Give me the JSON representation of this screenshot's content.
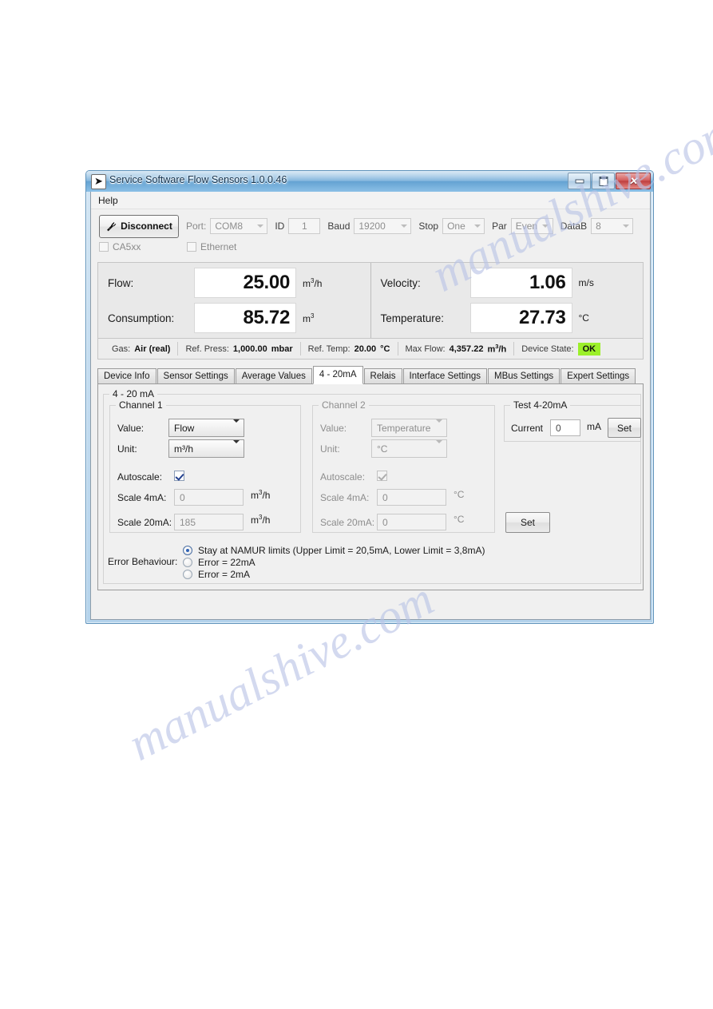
{
  "window": {
    "title": "Service Software Flow Sensors 1.0.0.46",
    "icon": "app-icon",
    "buttons": {
      "minimize": "minimize-icon",
      "maximize": "maximize-icon",
      "close": "close-icon"
    }
  },
  "menubar": {
    "items": [
      {
        "label": "Help"
      }
    ]
  },
  "toolbar": {
    "connect_button": "Disconnect",
    "port": {
      "label": "Port:",
      "value": "COM8"
    },
    "id": {
      "label": "ID",
      "value": "1"
    },
    "baud": {
      "label": "Baud",
      "value": "19200"
    },
    "stop": {
      "label": "Stop",
      "value": "One"
    },
    "par": {
      "label": "Par",
      "value": "Even"
    },
    "datab": {
      "label": "DataB",
      "value": "8"
    },
    "ca5xx": {
      "label": "CA5xx",
      "checked": false
    },
    "ethernet": {
      "label": "Ethernet",
      "checked": false
    }
  },
  "measurements": {
    "flow": {
      "label": "Flow:",
      "value": "25.00",
      "unit": "m",
      "unit_sup": "3",
      "unit_tail": "/h"
    },
    "consumption": {
      "label": "Consumption:",
      "value": "85.72",
      "unit": "m",
      "unit_sup": "3",
      "unit_tail": ""
    },
    "velocity": {
      "label": "Velocity:",
      "value": "1.06",
      "unit": "m/s",
      "unit_sup": "",
      "unit_tail": ""
    },
    "temperature": {
      "label": "Temperature:",
      "value": "27.73",
      "unit": "°C",
      "unit_sup": "",
      "unit_tail": ""
    }
  },
  "status": {
    "gas": {
      "label": "Gas:",
      "value": "Air (real)"
    },
    "ref_press": {
      "label": "Ref. Press:",
      "value": "1,000.00",
      "unit": "mbar"
    },
    "ref_temp": {
      "label": "Ref. Temp:",
      "value": "20.00",
      "unit": "°C"
    },
    "max_flow": {
      "label": "Max Flow:",
      "value": "4,357.22",
      "unit": "m",
      "unit_sup": "3",
      "unit_tail": "/h"
    },
    "device_state": {
      "label": "Device State:",
      "value": "OK",
      "color": "#9cf02a"
    }
  },
  "tabs": [
    {
      "label": "Device Info",
      "active": false
    },
    {
      "label": "Sensor Settings",
      "active": false
    },
    {
      "label": "Average Values",
      "active": false
    },
    {
      "label": "4 - 20mA",
      "active": true
    },
    {
      "label": "Relais",
      "active": false
    },
    {
      "label": "Interface Settings",
      "active": false
    },
    {
      "label": "MBus Settings",
      "active": false
    },
    {
      "label": "Expert Settings",
      "active": false
    }
  ],
  "page": {
    "group_title": "4 - 20 mA",
    "channel1": {
      "title": "Channel 1",
      "value_label": "Value:",
      "value_value": "Flow",
      "unit_label": "Unit:",
      "unit_value": "m³/h",
      "autoscale_label": "Autoscale:",
      "autoscale_checked": true,
      "scale4_label": "Scale 4mA:",
      "scale4_value": "0",
      "scale4_unit": "m",
      "scale4_unit_sup": "3",
      "scale4_unit_tail": "/h",
      "scale20_label": "Scale 20mA:",
      "scale20_value": "185",
      "scale20_unit": "m",
      "scale20_unit_sup": "3",
      "scale20_unit_tail": "/h"
    },
    "channel2": {
      "title": "Channel 2",
      "value_label": "Value:",
      "value_value": "Temperature",
      "unit_label": "Unit:",
      "unit_value": "°C",
      "autoscale_label": "Autoscale:",
      "autoscale_checked": true,
      "scale4_label": "Scale 4mA:",
      "scale4_value": "0",
      "scale4_unit": "°C",
      "scale20_label": "Scale 20mA:",
      "scale20_value": "0",
      "scale20_unit": "°C"
    },
    "test": {
      "title": "Test 4-20mA",
      "current_label": "Current",
      "current_value": "0",
      "current_unit": "mA",
      "set_button": "Set"
    },
    "apply_button": "Set",
    "error_behaviour": {
      "label": "Error Behaviour:",
      "options": [
        {
          "text": "Stay at NAMUR limits (Upper Limit = 20,5mA, Lower Limit = 3,8mA)",
          "selected": true
        },
        {
          "text": "Error = 22mA",
          "selected": false
        },
        {
          "text": "Error = 2mA",
          "selected": false
        }
      ]
    }
  },
  "watermark": {
    "line1": "manualshive.com",
    "line2": "manualshive.com"
  }
}
